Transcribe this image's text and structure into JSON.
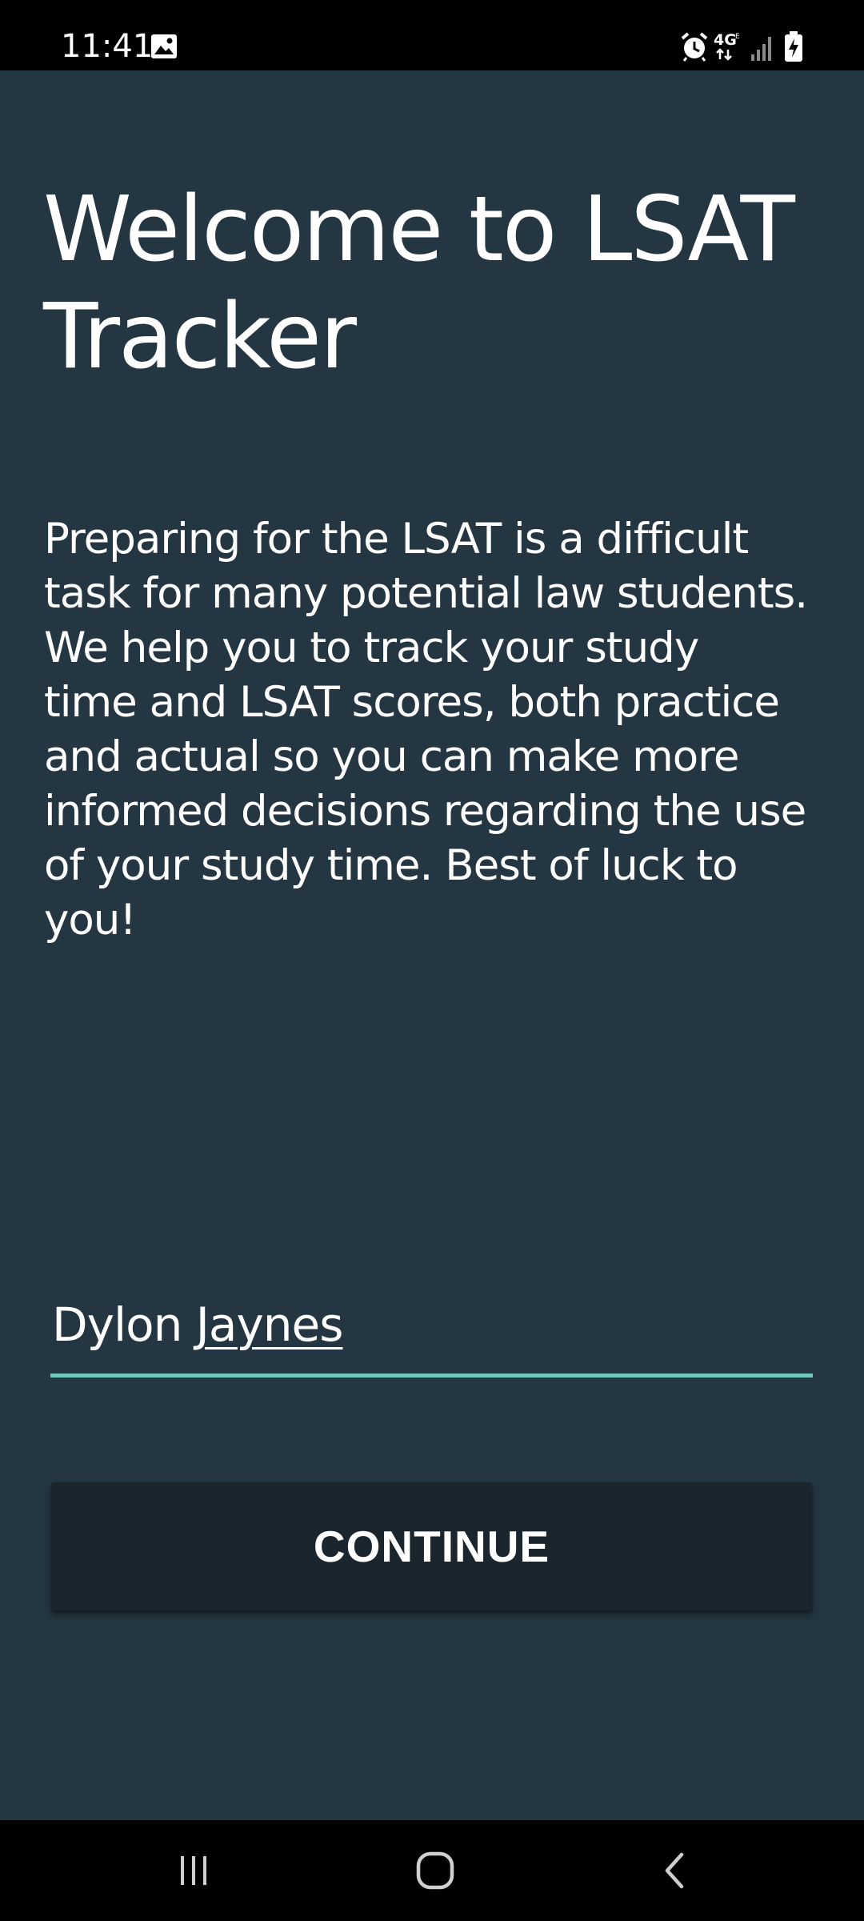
{
  "status_bar": {
    "time": "11:41",
    "icons": [
      "image-icon",
      "alarm-icon",
      "4g-network-icon",
      "signal-icon",
      "battery-charging-icon"
    ]
  },
  "welcome": {
    "title_line1": "Welcome to LSAT",
    "title_line2": "Tracker",
    "intro_lines": [
      "Preparing for the LSAT is a difficult",
      "task for many potential law students.",
      "We help you to track your study",
      "time and LSAT scores, both practice",
      "and actual so you can make more",
      "informed decisions regarding the use",
      "of your study time. Best of luck to",
      "you!"
    ]
  },
  "name_input": {
    "first": "Dylon",
    "last": "Jaynes",
    "accent_color": "#74c7bd"
  },
  "continue_button": {
    "label": "CONTINUE"
  },
  "nav_bar": {
    "icons": [
      "recent-apps-icon",
      "home-icon",
      "back-icon"
    ]
  },
  "colors": {
    "background": "#243641",
    "button": "#1a252d",
    "text": "#ffffff"
  }
}
